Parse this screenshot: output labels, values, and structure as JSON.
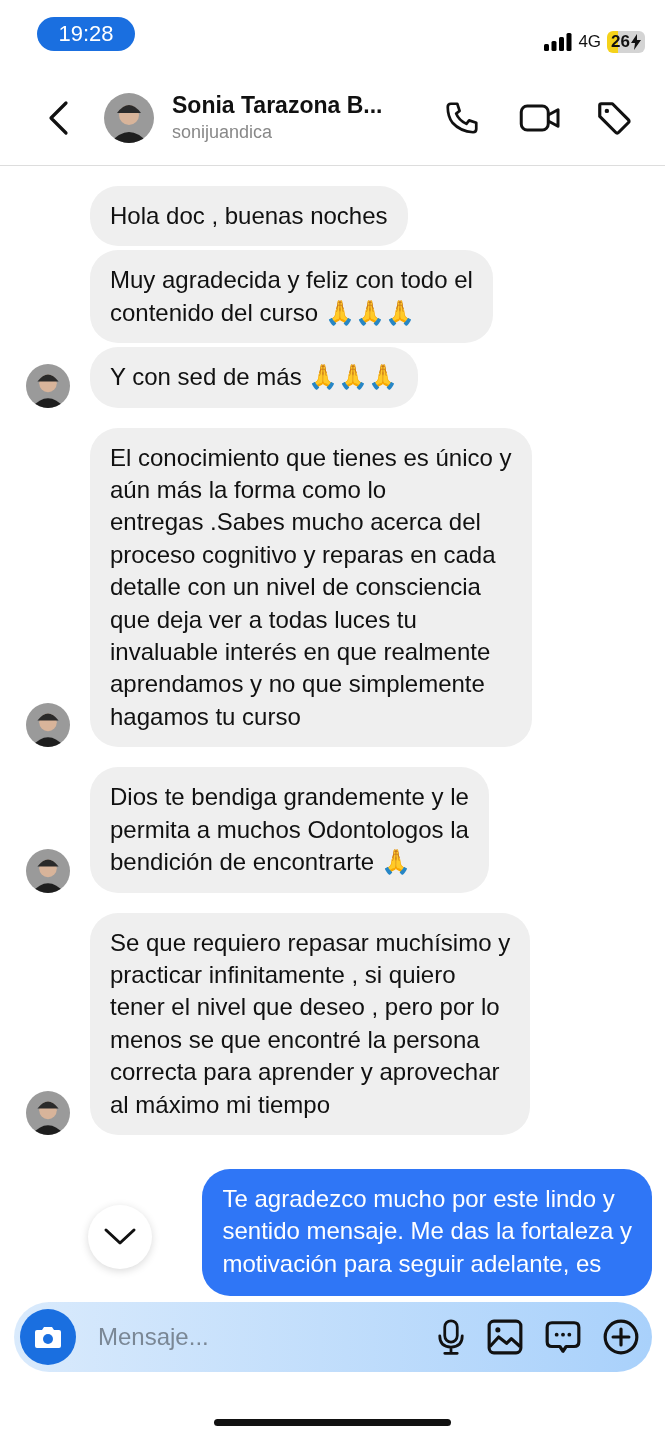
{
  "status_bar": {
    "time": "19:28",
    "network": "4G",
    "battery": "26",
    "charging": true
  },
  "header": {
    "name": "Sonia Tarazona B...",
    "username": "sonijuandica"
  },
  "messages": [
    {
      "kind": "received",
      "text": "Hola doc , buenas noches",
      "show_avatar": false
    },
    {
      "kind": "received",
      "text": "Muy agradecida y feliz con todo el\ncontenido del curso 🙏🙏🙏",
      "show_avatar": false
    },
    {
      "kind": "received",
      "text": "Y con sed de más 🙏🙏🙏",
      "show_avatar": true
    },
    {
      "kind": "received",
      "text": "El conocimiento que tienes es único y\naún más la forma como lo\nentregas .Sabes mucho acerca del\nproceso cognitivo y reparas en cada\ndetalle con un nivel de consciencia\nque deja ver a todas luces tu\ninvaluable interés en que realmente\naprendamos y no que simplemente\nhagamos tu curso",
      "show_avatar": true
    },
    {
      "kind": "received",
      "text": "Dios te bendiga grandemente y le\npermita a muchos Odontologos la\nbendición de encontrarte 🙏",
      "show_avatar": true
    },
    {
      "kind": "received",
      "text": "Se que requiero repasar muchísimo y\npracticar infinitamente , si quiero\ntener el nivel que deseo , pero por lo\nmenos se que encontré la persona\ncorrecta para aprender y aprovechar\nal máximo mi tiempo",
      "show_avatar": true
    },
    {
      "kind": "sent",
      "text": "Te agradezco mucho por este lindo y\nsentido mensaje. Me das la fortaleza y\nmotivación para seguir adelante, es"
    }
  ],
  "composer": {
    "placeholder": "Mensaje..."
  }
}
